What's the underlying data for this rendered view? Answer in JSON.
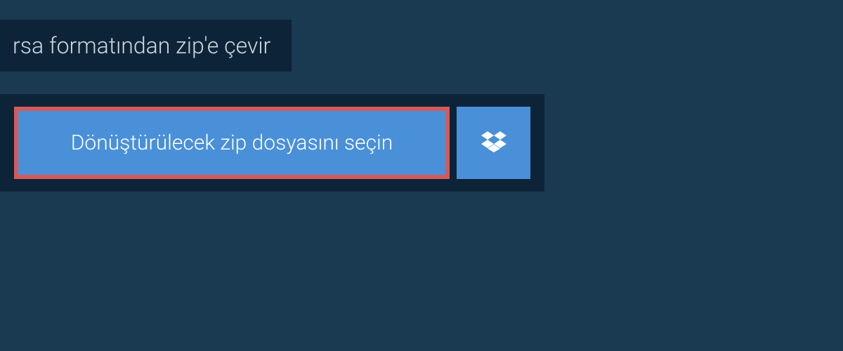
{
  "header": {
    "title": "rsa formatından zip'e çevir"
  },
  "upload": {
    "select_file_label": "Dönüştürülecek zip dosyasını seçin"
  },
  "colors": {
    "background": "#1a3a52",
    "panel": "#0d2438",
    "button": "#4a90d9",
    "highlight_border": "#d45a5a",
    "text_light": "#d0d8e0",
    "text_white": "#ffffff"
  }
}
